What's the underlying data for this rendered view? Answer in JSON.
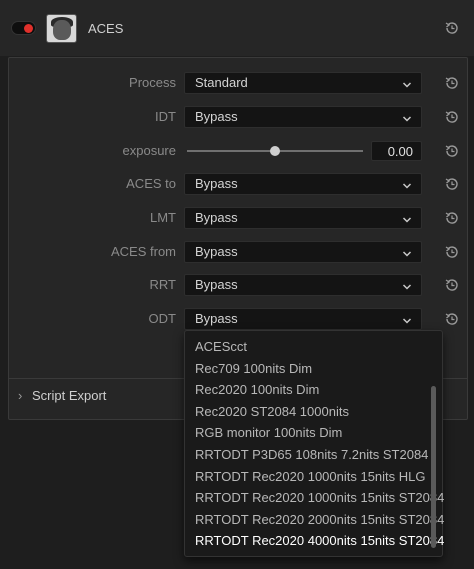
{
  "header": {
    "title": "ACES",
    "toggle_state": "on",
    "accent_red": "#e0302b"
  },
  "rows": [
    {
      "label": "Process",
      "value": "Standard"
    },
    {
      "label": "IDT",
      "value": "Bypass"
    },
    {
      "label": "exposure",
      "value": "0.00",
      "slider_fraction": 0.5
    },
    {
      "label": "ACES to",
      "value": "Bypass"
    },
    {
      "label": "LMT",
      "value": "Bypass"
    },
    {
      "label": "ACES from",
      "value": "Bypass"
    },
    {
      "label": "RRT",
      "value": "Bypass"
    },
    {
      "label": "ODT",
      "value": "Bypass"
    }
  ],
  "script_export": {
    "label": "Script Export"
  },
  "odt_menu": {
    "items": [
      "ACEScct",
      "Rec709 100nits Dim",
      "Rec2020 100nits Dim",
      "Rec2020 ST2084 1000nits",
      "RGB monitor 100nits Dim",
      "RRTODT P3D65 108nits 7.2nits ST2084",
      "RRTODT Rec2020 1000nits 15nits HLG",
      "RRTODT Rec2020 1000nits 15nits ST2084",
      "RRTODT Rec2020 2000nits 15nits ST2084",
      "RRTODT Rec2020 4000nits 15nits ST2084"
    ],
    "selected": "RRTODT Rec2020 4000nits 15nits ST2084"
  },
  "icons": {
    "reset": "reset-icon",
    "chevron": "chevron-down-icon",
    "expand": "chevron-right-icon"
  }
}
